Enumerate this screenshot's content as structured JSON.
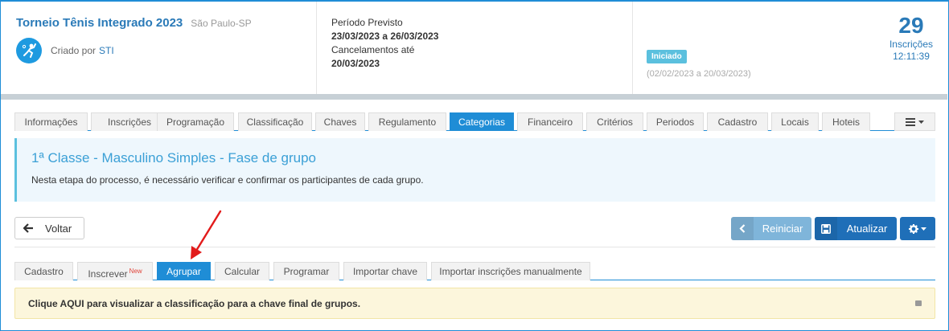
{
  "event": {
    "title": "Torneio Tênis Integrado 2023",
    "location": "São Paulo-SP",
    "created_by_label": "Criado por",
    "created_by": "STI"
  },
  "period": {
    "label": "Período Previsto",
    "dates": "23/03/2023 a 26/03/2023",
    "cancel_label": "Cancelamentos até",
    "cancel_date": "20/03/2023"
  },
  "status": {
    "badge": "Iniciado",
    "range": "(02/02/2023 a 20/03/2023)"
  },
  "stats": {
    "count": "29",
    "count_label": "Inscrições",
    "time": "12:11:39"
  },
  "tabs": [
    {
      "label": "Informações"
    },
    {
      "label": "Inscrições"
    },
    {
      "label": "Programação"
    },
    {
      "label": "Classificação"
    },
    {
      "label": "Chaves"
    },
    {
      "label": "Regulamento"
    },
    {
      "label": "Categorias",
      "active": true
    },
    {
      "label": "Financeiro"
    },
    {
      "label": "Critérios"
    },
    {
      "label": "Periodos"
    },
    {
      "label": "Cadastro"
    },
    {
      "label": "Locais"
    },
    {
      "label": "Hoteis"
    }
  ],
  "info": {
    "heading": "1ª Classe - Masculino Simples - Fase de grupo",
    "text": "Nesta etapa do processo, é necessário verificar e confirmar os participantes de cada grupo."
  },
  "actions": {
    "back": "Voltar",
    "reiniciar": "Reiniciar",
    "atualizar": "Atualizar"
  },
  "sub_tabs": [
    {
      "label": "Cadastro"
    },
    {
      "label": "Inscrever",
      "sup": "New"
    },
    {
      "label": "Agrupar",
      "active": true
    },
    {
      "label": "Calcular"
    },
    {
      "label": "Programar"
    },
    {
      "label": "Importar chave"
    },
    {
      "label": "Importar inscrições manualmente"
    }
  ],
  "alert": {
    "text": "Clique AQUI para visualizar a classificação para a chave final de grupos."
  },
  "colors": {
    "primary": "#1f8dd6",
    "badge": "#5bc0de",
    "annotation_arrow": "#e21b1b"
  }
}
